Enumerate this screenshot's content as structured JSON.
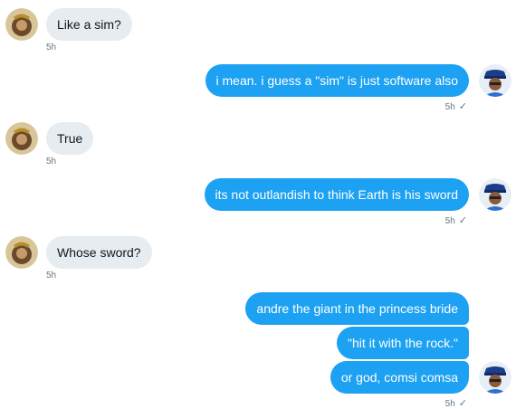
{
  "messages": [
    {
      "side": "in",
      "text": "Like a sim?",
      "time": "5h"
    },
    {
      "side": "out",
      "text": "i mean.  i guess a \"sim\" is just software also",
      "time": "5h",
      "status": "✓"
    },
    {
      "side": "in",
      "text": "True",
      "time": "5h"
    },
    {
      "side": "out",
      "text": "its not outlandish to think Earth is his sword",
      "time": "5h",
      "status": "✓"
    },
    {
      "side": "in",
      "text": "Whose sword?",
      "time": "5h"
    },
    {
      "side": "out",
      "text": "andre the giant in the princess bride"
    },
    {
      "side": "out",
      "text": "\"hit it with the rock.\""
    },
    {
      "side": "out",
      "text": "or god, comsi comsa",
      "time": "5h",
      "status": "✓"
    }
  ],
  "colors": {
    "outgoing": "#1da1f2",
    "incoming": "#e6ecf0",
    "meta": "#657786"
  },
  "icons": {
    "incoming_avatar": "avatar-woman-gold-headpiece",
    "outgoing_avatar": "avatar-man-blue-cap"
  }
}
